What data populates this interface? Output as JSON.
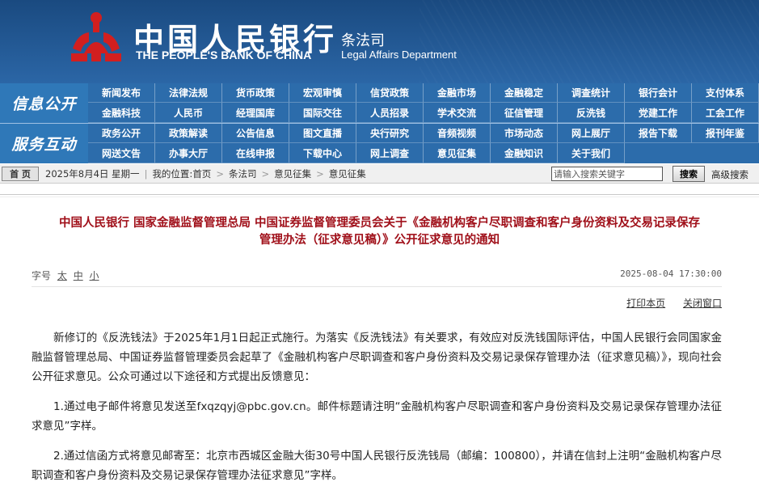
{
  "header": {
    "bank_cn": "中国人民银行",
    "bank_en": "THE PEOPLE'S BANK OF CHINA",
    "dept_cn": "条法司",
    "dept_en": "Legal Affairs Department",
    "logo_icon": "pboc-emblem-icon",
    "colors": {
      "banner": "#1d4f86",
      "nav": "#2c6cab",
      "title": "#a0101a",
      "emblem": "#d21f1f"
    }
  },
  "nav": {
    "section1": {
      "label": "信息公开",
      "items": [
        "新闻发布",
        "法律法规",
        "货币政策",
        "宏观审慎",
        "信贷政策",
        "金融市场",
        "金融稳定",
        "调查统计",
        "银行会计",
        "支付体系",
        "金融科技",
        "人民币",
        "经理国库",
        "国际交往",
        "人员招录",
        "学术交流",
        "征信管理",
        "反洗钱",
        "党建工作",
        "工会工作"
      ]
    },
    "section2": {
      "label": "服务互动",
      "items": [
        "政务公开",
        "政策解读",
        "公告信息",
        "图文直播",
        "央行研究",
        "音频视频",
        "市场动态",
        "网上展厅",
        "报告下载",
        "报刊年鉴",
        "网送文告",
        "办事大厅",
        "在线申报",
        "下载中心",
        "网上调查",
        "意见征集",
        "金融知识",
        "关于我们"
      ]
    }
  },
  "breadcrumb": {
    "home": "首 页",
    "date": "2025年8月4日 星期一",
    "location_label": "我的位置:",
    "path": [
      "首页",
      "条法司",
      "意见征集",
      "意见征集"
    ],
    "search_placeholder": "请输入搜索关键字",
    "search_button": "搜索",
    "advanced_search": "高级搜索"
  },
  "article": {
    "title_line1": "中国人民银行 国家金融监督管理总局 中国证券监督管理委员会关于《金融机构客户尽职调查和客户身份资料及交易记录保存",
    "title_line2": "管理办法（征求意见稿）》公开征求意见的通知",
    "font_size_label": "字号",
    "font_sizes": [
      "太",
      "中",
      "小"
    ],
    "pubdate": "2025-08-04 17:30:00",
    "print": "打印本页",
    "close": "关闭窗口",
    "paragraphs": [
      "新修订的《反洗钱法》于2025年1月1日起正式施行。为落实《反洗钱法》有关要求，有效应对反洗钱国际评估，中国人民银行会同国家金融监督管理总局、中国证券监督管理委员会起草了《金融机构客户尽职调查和客户身份资料及交易记录保存管理办法（征求意见稿）》，现向社会公开征求意见。公众可通过以下途径和方式提出反馈意见：",
      "1.通过电子邮件将意见发送至fxqzqyj@pbc.gov.cn。邮件标题请注明“金融机构客户尽职调查和客户身份资料及交易记录保存管理办法征求意见”字样。",
      "2.通过信函方式将意见邮寄至：北京市西城区金融大街30号中国人民银行反洗钱局（邮编：100800），并请在信封上注明“金融机构客户尽职调查和客户身份资料及交易记录保存管理办法征求意见”字样。"
    ]
  }
}
